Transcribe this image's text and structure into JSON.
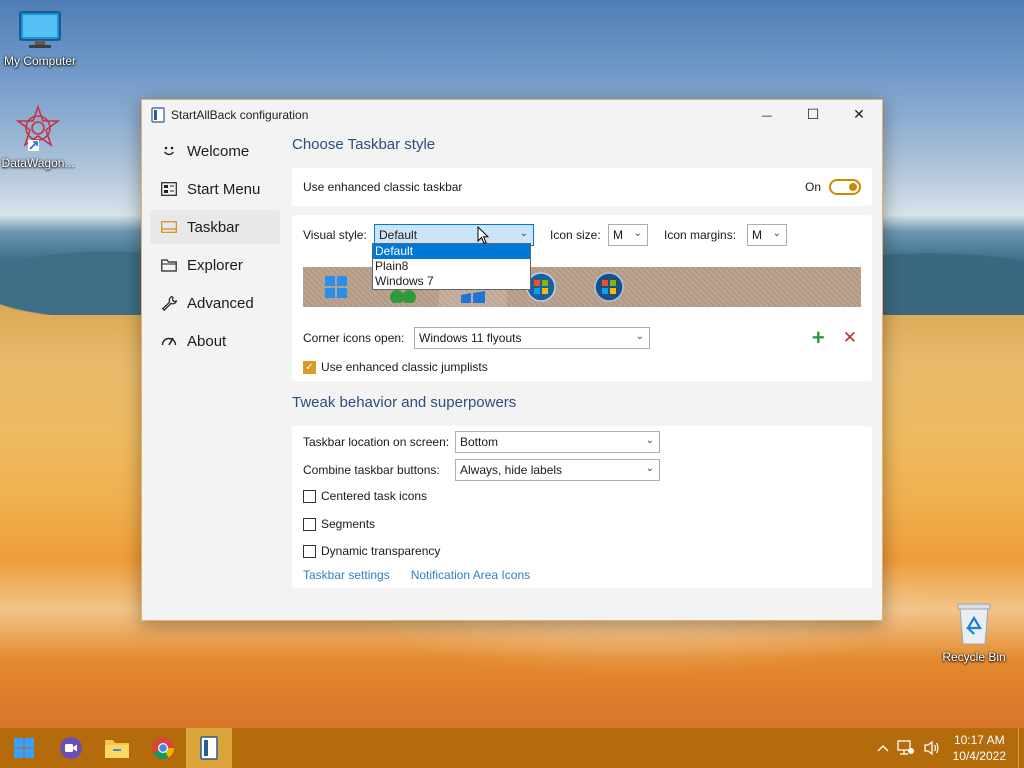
{
  "desktop": {
    "icons": [
      {
        "label": "My Computer"
      },
      {
        "label": "DataWagon..."
      },
      {
        "label": "Recycle Bin"
      }
    ]
  },
  "window": {
    "title": "StartAllBack configuration",
    "controls": {
      "minimize": "—",
      "maximize": "☐",
      "close": "✕"
    }
  },
  "sidebar": {
    "items": [
      {
        "label": "Welcome",
        "icon": "smile-icon"
      },
      {
        "label": "Start Menu",
        "icon": "start-menu-icon"
      },
      {
        "label": "Taskbar",
        "icon": "taskbar-icon"
      },
      {
        "label": "Explorer",
        "icon": "folder-icon"
      },
      {
        "label": "Advanced",
        "icon": "wrench-icon"
      },
      {
        "label": "About",
        "icon": "gauge-icon"
      }
    ],
    "active_index": 2
  },
  "taskbar_style": {
    "section_title": "Choose Taskbar style",
    "enhanced_label": "Use enhanced classic taskbar",
    "toggle_state": "On",
    "visual_style_label": "Visual style:",
    "visual_style_value": "Default",
    "visual_style_options": [
      "Default",
      "Plain8",
      "Windows 7"
    ],
    "icon_size_label": "Icon size:",
    "icon_size_value": "M",
    "icon_margins_label": "Icon margins:",
    "icon_margins_value": "M",
    "corner_icons_label": "Corner icons open:",
    "corner_icons_value": "Windows 11 flyouts",
    "add_symbol": "+",
    "remove_symbol": "✕",
    "jumplists_label": "Use enhanced classic jumplists",
    "jumplists_checked": true
  },
  "behavior": {
    "section_title": "Tweak behavior and superpowers",
    "location_label": "Taskbar location on screen:",
    "location_value": "Bottom",
    "combine_label": "Combine taskbar buttons:",
    "combine_value": "Always, hide labels",
    "centered_label": "Centered task icons",
    "segments_label": "Segments",
    "transparency_label": "Dynamic transparency",
    "link_taskbar": "Taskbar settings",
    "link_notification": "Notification Area Icons"
  },
  "taskbar": {
    "time": "10:17 AM",
    "date": "10/4/2022",
    "accent": "#b36b0c"
  },
  "colors": {
    "accent": "#cc8a00",
    "heading": "#2b4f7c",
    "link": "#2f7fc9",
    "selection": "#0078d7"
  }
}
